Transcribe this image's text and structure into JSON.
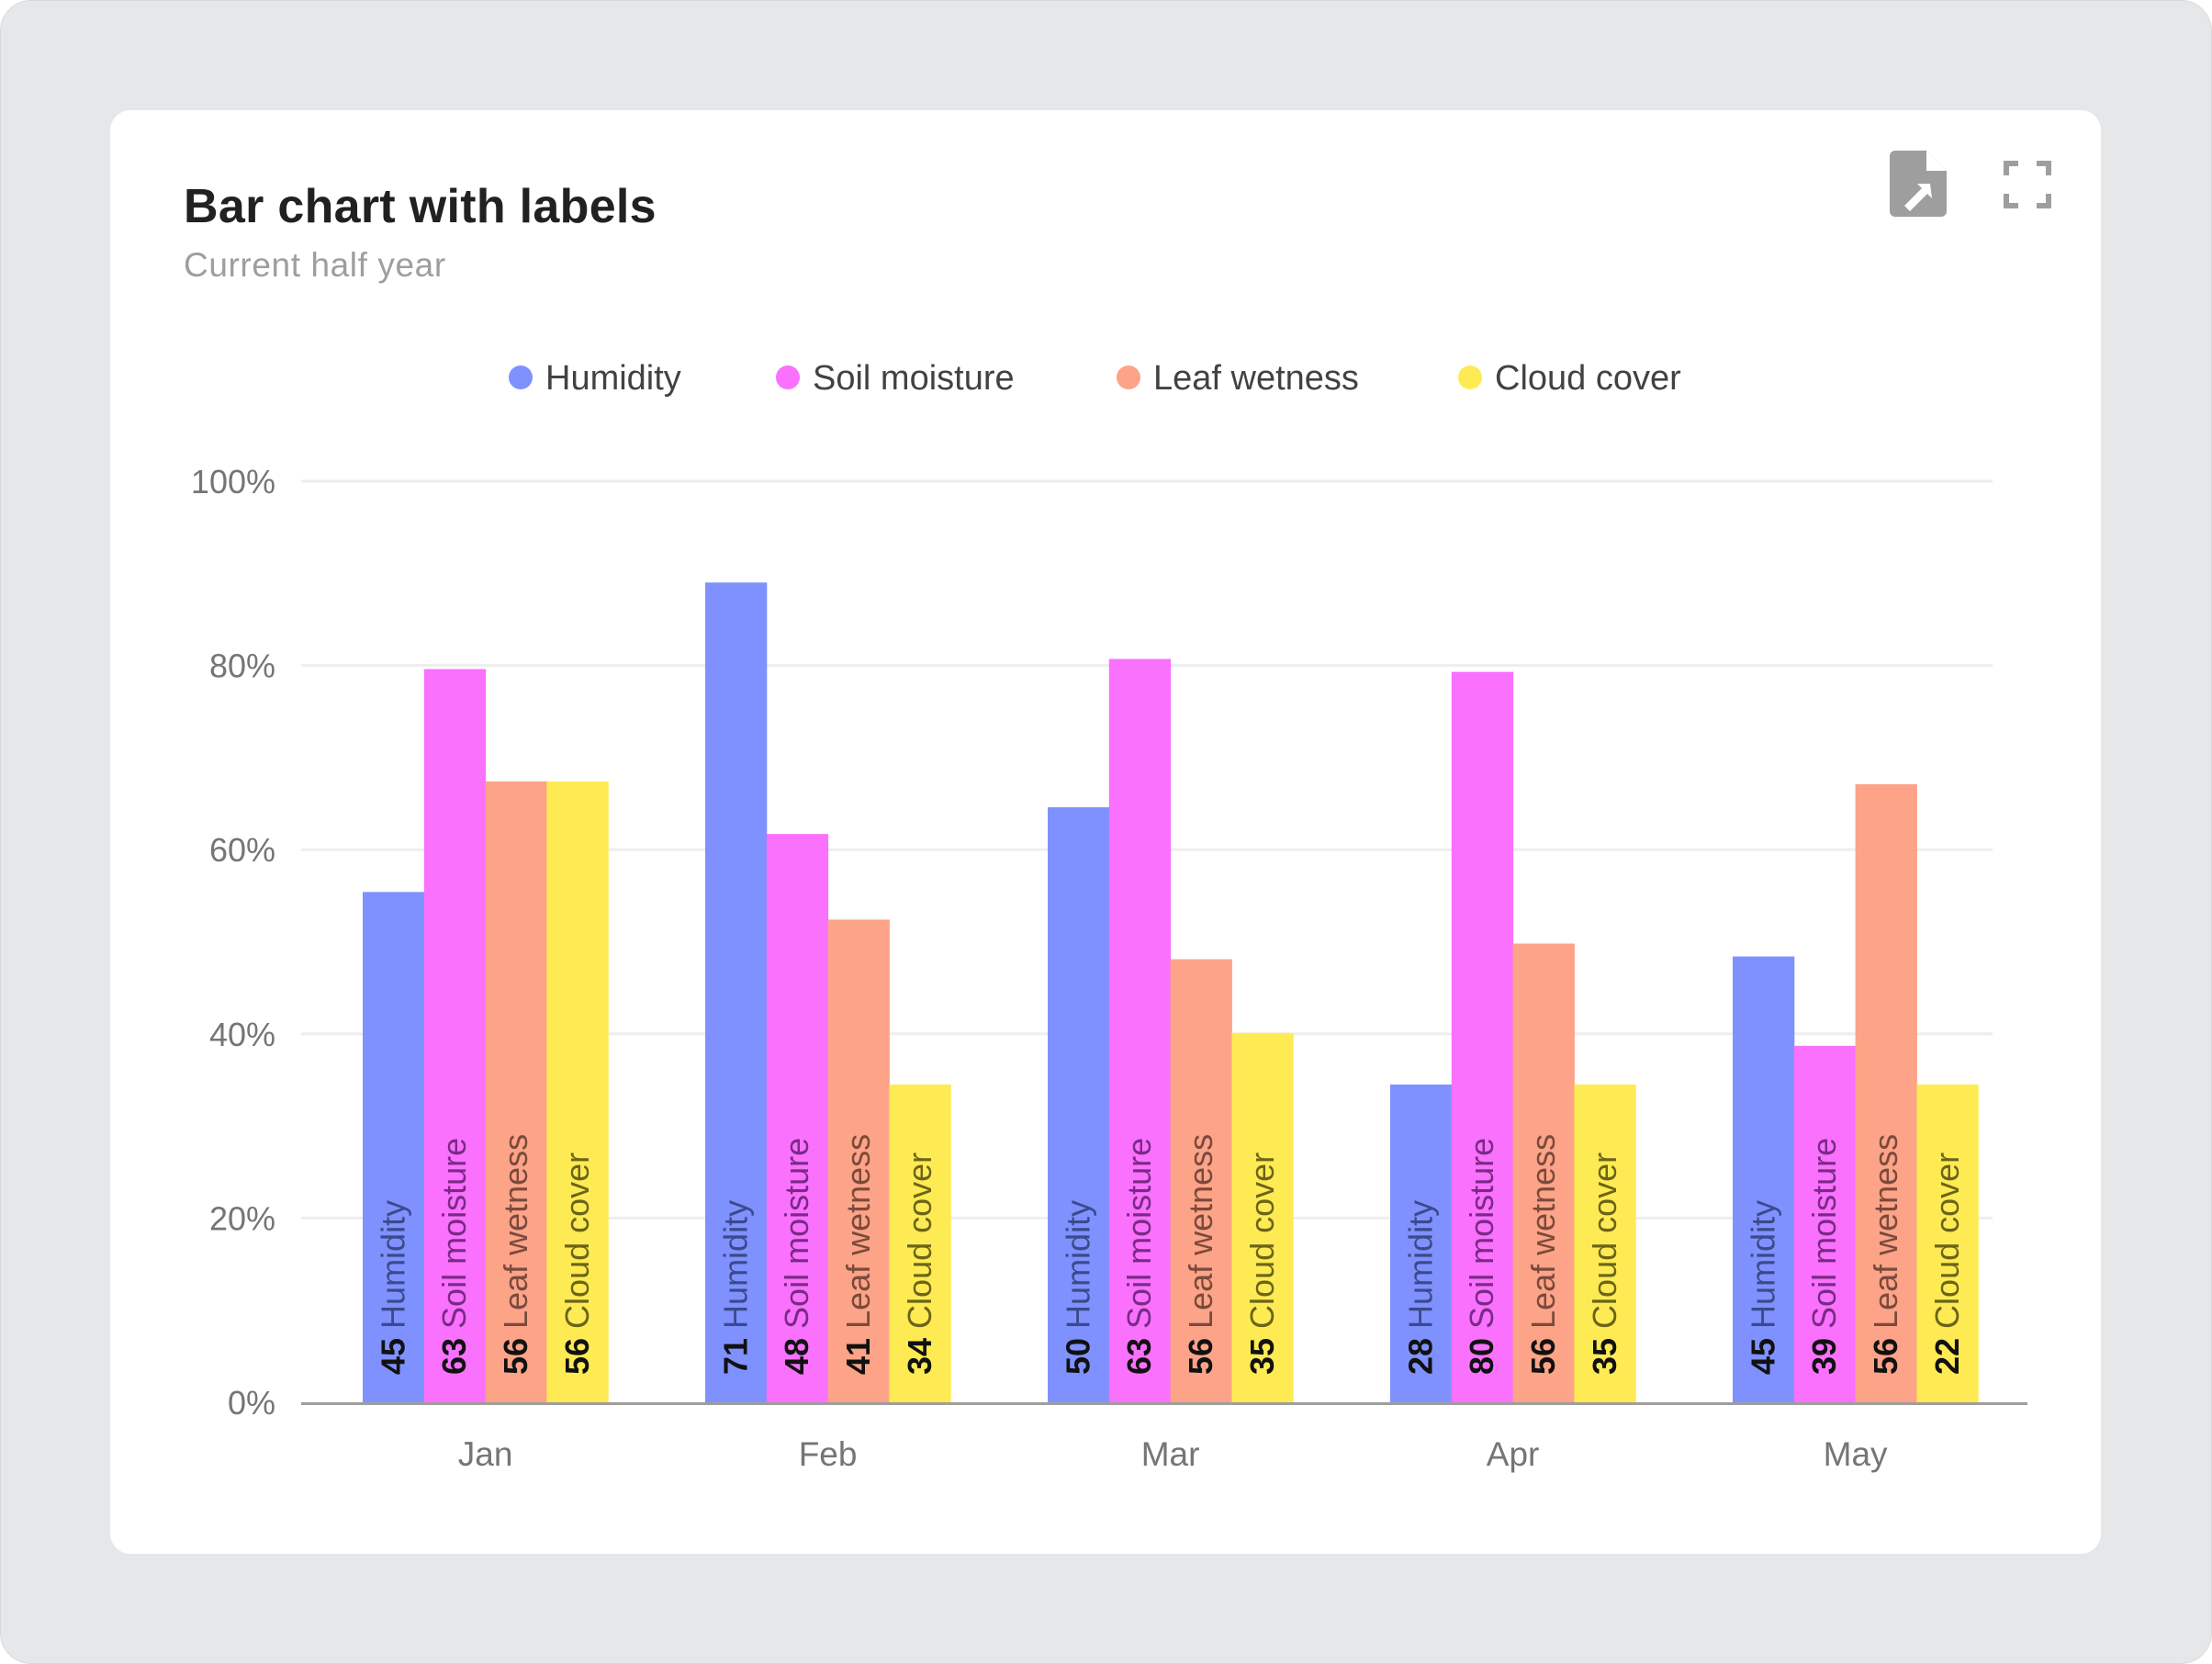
{
  "card": {
    "title": "Bar chart with labels",
    "subtitle": "Current half year",
    "actions": [
      {
        "name": "export-icon",
        "label": "Export"
      },
      {
        "name": "fullscreen-icon",
        "label": "Fullscreen"
      }
    ]
  },
  "colors": {
    "background": "#e6e7e9",
    "card": "#ffffff",
    "gridline": "#eeeeee",
    "axis": "#9e9e9e"
  },
  "chart_data": {
    "type": "bar",
    "title": "Bar chart with labels",
    "subtitle": "Current half year",
    "xlabel": "",
    "ylabel": "",
    "categories": [
      "Jan",
      "Feb",
      "Mar",
      "Apr",
      "May"
    ],
    "ylim": [
      0,
      100
    ],
    "yticks": [
      0,
      20,
      40,
      60,
      80,
      100
    ],
    "ytick_labels": [
      "0%",
      "20%",
      "40%",
      "60%",
      "80%",
      "100%"
    ],
    "grid": true,
    "legend_position": "top-center",
    "series": [
      {
        "name": "Humidity",
        "color": "#7f91ff",
        "label_text_color": "#3a4a8a",
        "values": [
          55.4,
          89,
          64.6,
          34.5,
          48.4
        ],
        "data_labels": [
          45,
          71,
          50,
          28,
          45
        ]
      },
      {
        "name": "Soil moisture",
        "color": "#f971fd",
        "label_text_color": "#7a2a86",
        "values": [
          79.6,
          61.7,
          80.7,
          79.3,
          38.7
        ],
        "data_labels": [
          63,
          48,
          63,
          80,
          39
        ]
      },
      {
        "name": "Leaf wetness",
        "color": "#fca388",
        "label_text_color": "#7a4a3c",
        "values": [
          67.4,
          52.4,
          48.1,
          49.8,
          67.1
        ],
        "data_labels": [
          56,
          41,
          56,
          56,
          56
        ]
      },
      {
        "name": "Cloud cover",
        "color": "#feeb53",
        "label_text_color": "#6b6418",
        "values": [
          67.4,
          34.5,
          40.1,
          34.5,
          34.5
        ],
        "data_labels": [
          56,
          34,
          35,
          35,
          22
        ]
      }
    ]
  }
}
